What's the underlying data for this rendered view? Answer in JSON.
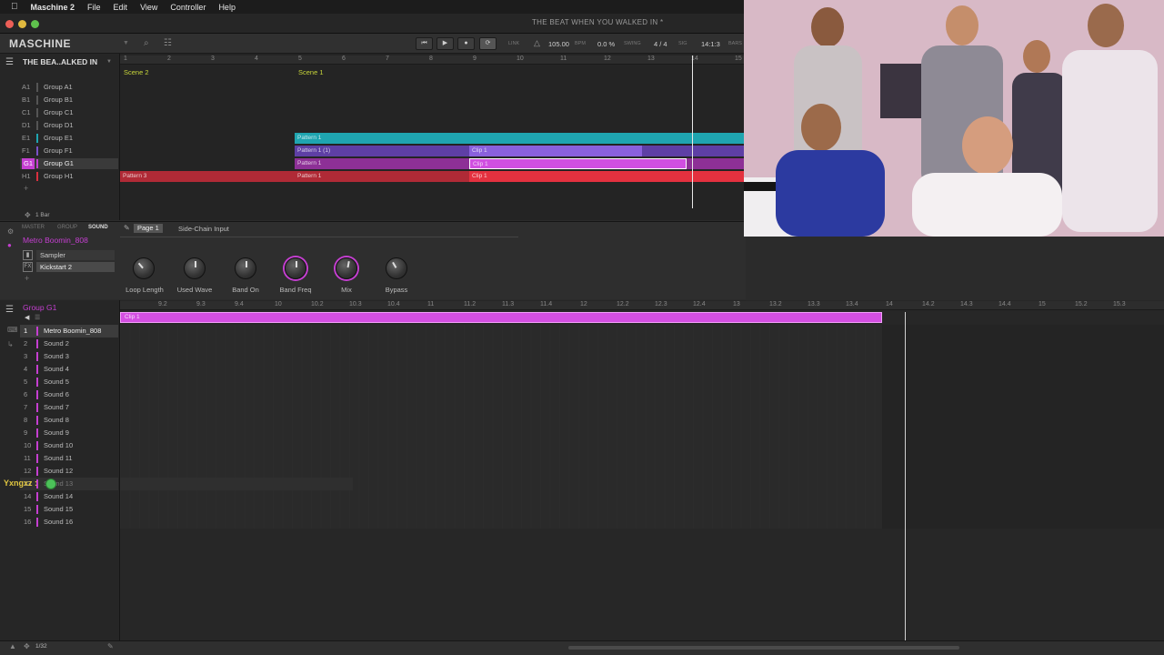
{
  "menubar": {
    "apple": "",
    "app_name": "Maschine 2",
    "items": [
      "File",
      "Edit",
      "View",
      "Controller",
      "Help"
    ]
  },
  "window": {
    "title": "THE BEAT WHEN YOU WALKED IN *"
  },
  "header": {
    "logo": "MASCHINE",
    "link_label": "LINK",
    "bpm_value": "105.00",
    "bpm_unit": "BPM",
    "swing_value": "0.0 %",
    "swing_label": "SWING",
    "sig_value": "4 / 4",
    "sig_label": "SIG",
    "position_value": "14:1:3",
    "position_label": "BARS"
  },
  "arranger": {
    "project_title": "THE BEA..ALKED IN",
    "zoom_label": "1 Bar",
    "ruler": [
      "1",
      "2",
      "3",
      "4",
      "5",
      "6",
      "7",
      "8",
      "9",
      "10",
      "11",
      "12",
      "13",
      "14",
      "15"
    ],
    "scenes": [
      "Scene 2",
      "Scene 1"
    ],
    "groups": [
      {
        "id": "A1",
        "name": "Group A1",
        "color": "#7a7a7a"
      },
      {
        "id": "B1",
        "name": "Group B1",
        "color": "#7a7a7a"
      },
      {
        "id": "C1",
        "name": "Group C1",
        "color": "#7a7a7a"
      },
      {
        "id": "D1",
        "name": "Group D1",
        "color": "#7a7a7a"
      },
      {
        "id": "E1",
        "name": "Group E1",
        "color": "#1fa5b0"
      },
      {
        "id": "F1",
        "name": "Group F1",
        "color": "#7a52c7"
      },
      {
        "id": "G1",
        "name": "Group G1",
        "color": "#c53fd1"
      },
      {
        "id": "H1",
        "name": "Group H1",
        "color": "#d9303f"
      }
    ],
    "clips": {
      "e1_pattern": "Pattern 1",
      "f1_pattern": "Pattern 1 (1)",
      "f1_clip": "Clip 1",
      "g1_pattern": "Pattern 1",
      "g1_clip": "Clip 1",
      "h1_pattern_a": "Pattern 3",
      "h1_pattern_b": "Pattern 1",
      "h1_clip": "Clip 1"
    }
  },
  "sound_panel": {
    "tab_master": "MASTER",
    "tab_group": "GROUP",
    "tab_sound": "SOUND",
    "sound_name": "Metro Boomin_808",
    "sampler": "Sampler",
    "fx": "Kickstart 2",
    "page_tab": "Page 1",
    "sidechain_tab": "Side-Chain Input",
    "knobs": [
      "Loop Length",
      "Used Wave",
      "Band On",
      "Band Freq",
      "Mix",
      "Bypass"
    ]
  },
  "pattern_editor": {
    "group_name": "Group G1",
    "clip_label": "Clip 1",
    "ruler": [
      "9.2",
      "9.3",
      "9.4",
      "10",
      "10.2",
      "10.3",
      "10.4",
      "11",
      "11.2",
      "11.3",
      "11.4",
      "12",
      "12.2",
      "12.3",
      "12.4",
      "13",
      "13.2",
      "13.3",
      "13.4",
      "14",
      "14.2",
      "14.3",
      "14.4",
      "15",
      "15.2",
      "15.3"
    ],
    "sounds": [
      {
        "num": "1",
        "name": "Metro Boomin_808"
      },
      {
        "num": "2",
        "name": "Sound 2"
      },
      {
        "num": "3",
        "name": "Sound 3"
      },
      {
        "num": "4",
        "name": "Sound 4"
      },
      {
        "num": "5",
        "name": "Sound 5"
      },
      {
        "num": "6",
        "name": "Sound 6"
      },
      {
        "num": "7",
        "name": "Sound 7"
      },
      {
        "num": "8",
        "name": "Sound 8"
      },
      {
        "num": "9",
        "name": "Sound 9"
      },
      {
        "num": "10",
        "name": "Sound 10"
      },
      {
        "num": "11",
        "name": "Sound 11"
      },
      {
        "num": "12",
        "name": "Sound 12"
      },
      {
        "num": "13",
        "name": "Sound 13"
      },
      {
        "num": "14",
        "name": "Sound 14"
      },
      {
        "num": "15",
        "name": "Sound 15"
      },
      {
        "num": "16",
        "name": "Sound 16"
      }
    ],
    "overlay_text": "Yxngxz :",
    "step_label": "1/32"
  },
  "colors": {
    "accent": "#c53fd1",
    "teal": "#1fa5b0",
    "purple": "#7a52c7",
    "red": "#d9303f",
    "scene": "#c8d63a"
  }
}
